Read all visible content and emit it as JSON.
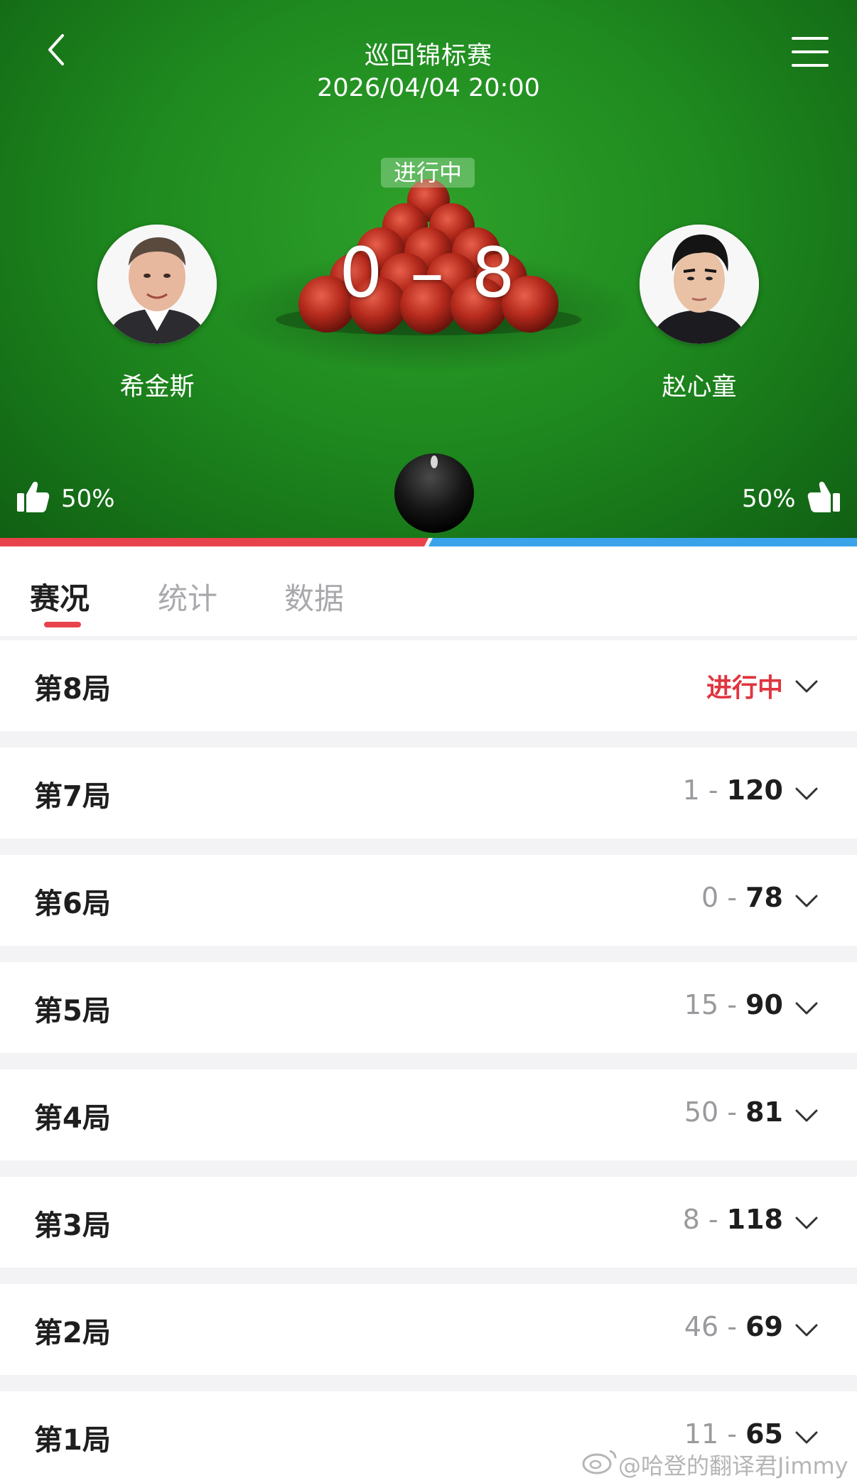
{
  "header": {
    "event_title": "巡回锦标赛",
    "datetime": "2026/04/04 20:00",
    "status": "进行中",
    "score": "0 – 8",
    "left_player": {
      "name": "希金斯",
      "support_pct": "50%"
    },
    "right_player": {
      "name": "赵心童",
      "support_pct": "50%"
    },
    "support_split": 0.5,
    "colors": {
      "left": "#e8424c",
      "right": "#3aa3ea",
      "table": "#1f8a1f"
    }
  },
  "tabs": [
    {
      "label": "赛况",
      "active": true
    },
    {
      "label": "统计",
      "active": false
    },
    {
      "label": "数据",
      "active": false
    }
  ],
  "frames": [
    {
      "title": "第8局",
      "status": "进行中"
    },
    {
      "title": "第7局",
      "score_a": "1",
      "sep": " - ",
      "score_b": "120"
    },
    {
      "title": "第6局",
      "score_a": "0",
      "sep": " - ",
      "score_b": "78"
    },
    {
      "title": "第5局",
      "score_a": "15",
      "sep": " - ",
      "score_b": "90"
    },
    {
      "title": "第4局",
      "score_a": "50",
      "sep": " - ",
      "score_b": "81"
    },
    {
      "title": "第3局",
      "score_a": "8",
      "sep": " - ",
      "score_b": "118"
    },
    {
      "title": "第2局",
      "score_a": "46",
      "sep": " - ",
      "score_b": "69"
    },
    {
      "title": "第1局",
      "score_a": "11",
      "sep": " - ",
      "score_b": "65"
    }
  ],
  "watermark": "@哈登的翻译君Jimmy"
}
